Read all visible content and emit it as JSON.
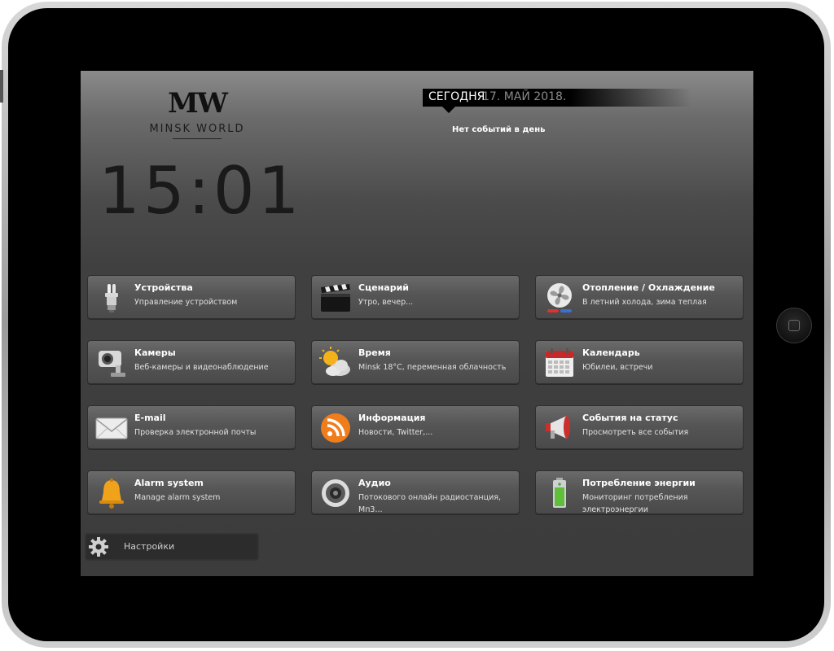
{
  "logo": {
    "mark": "MW",
    "text": "MINSK WORLD"
  },
  "clock": "15:01",
  "date": {
    "today_label": "СЕГОДНЯ",
    "value": "17. МАЙ 2018."
  },
  "events": {
    "empty_text": "Нет событий в день"
  },
  "tiles": [
    {
      "title": "Устройства",
      "subtitle": "Управление устройством",
      "icon": "light-bulb-icon"
    },
    {
      "title": "Сценарий",
      "subtitle": "Утро, вечер...",
      "icon": "clapperboard-icon"
    },
    {
      "title": "Отопление / Охлаждение",
      "subtitle": "В летний холода, зима теплая",
      "icon": "fan-icon"
    },
    {
      "title": "Камеры",
      "subtitle": "Веб-камеры и видеонаблюдение",
      "icon": "camera-icon"
    },
    {
      "title": "Время",
      "subtitle": "Minsk 18°C, переменная облачность",
      "icon": "weather-icon"
    },
    {
      "title": "Календарь",
      "subtitle": "Юбилеи, встречи",
      "icon": "calendar-icon"
    },
    {
      "title": "E-mail",
      "subtitle": "Проверка электронной почты",
      "icon": "envelope-icon"
    },
    {
      "title": "Информация",
      "subtitle": "Новости, Twitter,...",
      "icon": "rss-icon"
    },
    {
      "title": "События на статус",
      "subtitle": "Просмотреть все события",
      "icon": "megaphone-icon"
    },
    {
      "title": "Alarm system",
      "subtitle": "Manage alarm system",
      "icon": "bell-icon"
    },
    {
      "title": "Аудио",
      "subtitle": "Потокового онлайн радиостанция, Мп3...",
      "icon": "speaker-icon"
    },
    {
      "title": "Потребление энергии",
      "subtitle": "Мониторинг потребления электроэнергии",
      "icon": "battery-icon"
    }
  ],
  "settings": {
    "label": "Настройки",
    "icon": "gear-icon"
  },
  "colors": {
    "accent_orange": "#f07d1c",
    "screen_bg": "#404040",
    "tablet_frame": "#000000"
  }
}
